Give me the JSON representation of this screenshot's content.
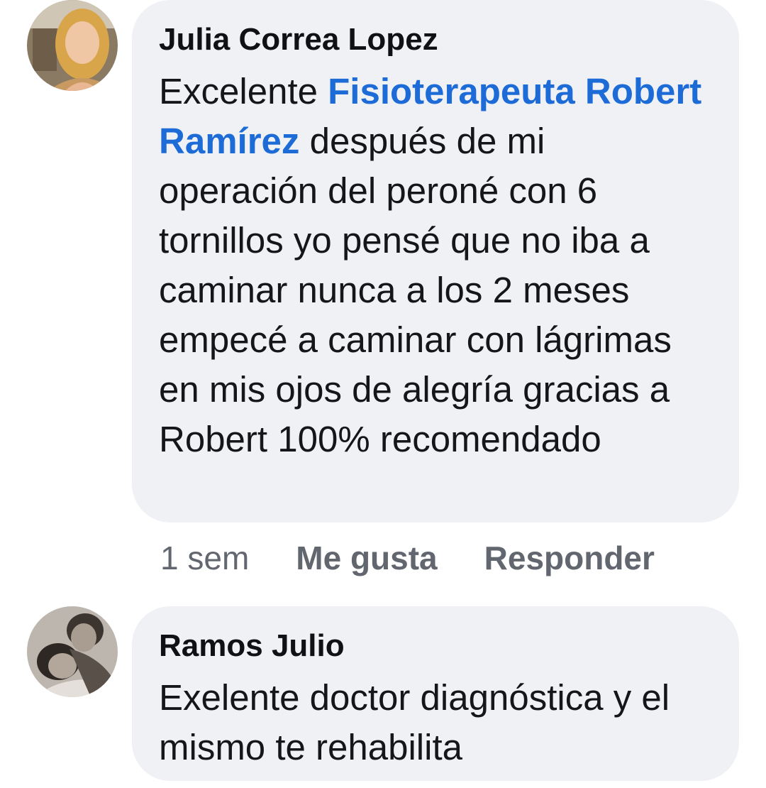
{
  "comments": [
    {
      "author": "Julia Correa Lopez",
      "text_before": "Excelente ",
      "mention": "Fisioterapeuta Robert Ramírez",
      "text_after": " después de mi operación del peroné con 6 tornillos yo pensé que no iba a caminar nunca a los 2 meses empecé a caminar con lágrimas en mis ojos de alegría gracias a Robert 100% recomendado",
      "time": "1 sem",
      "like_label": "Me gusta",
      "reply_label": "Responder"
    },
    {
      "author": "Ramos Julio",
      "text": "Exelente doctor diagnóstica y el mismo te rehabilita"
    }
  ],
  "colors": {
    "bubble": "#eff1f5",
    "mention": "#1d6bd6",
    "meta": "#62666e"
  }
}
